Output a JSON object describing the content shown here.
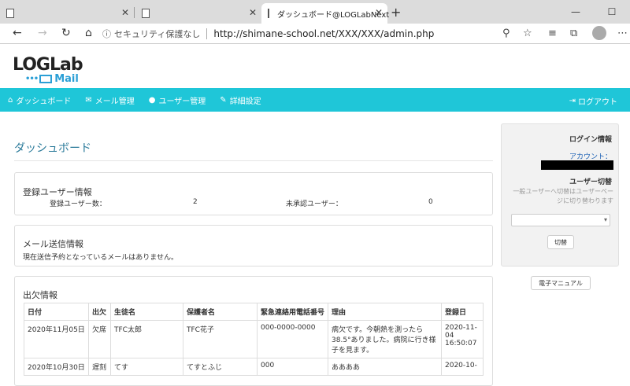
{
  "browser": {
    "tabs": [
      {
        "title": ""
      },
      {
        "title": ""
      },
      {
        "title": "ダッシュボード@LOGLabNext"
      }
    ],
    "insecure_label": "セキュリティ保護なし",
    "url": "http://shimane-school.net/XXX/XXX/admin.php"
  },
  "logo": {
    "main": "LOGLab",
    "sub": "Mail"
  },
  "nav": {
    "items": [
      {
        "label": "ダッシュボード",
        "icon": "home-icon"
      },
      {
        "label": "メール管理",
        "icon": "mail-icon"
      },
      {
        "label": "ユーザー管理",
        "icon": "user-icon"
      },
      {
        "label": "詳細設定",
        "icon": "wrench-icon"
      }
    ],
    "logout": "ログアウト"
  },
  "main": {
    "title": "ダッシュボード",
    "users_panel": {
      "title": "登録ユーザー情報",
      "registered_label": "登録ユーザー数：",
      "registered_value": "2",
      "pending_label": "未承認ユーザー：",
      "pending_value": "0"
    },
    "mail_panel": {
      "title": "メール送信情報",
      "message": "現在送信予約となっているメールはありません。"
    },
    "attendance_panel": {
      "title": "出欠情報",
      "columns": [
        "日付",
        "出欠",
        "生徒名",
        "保護者名",
        "緊急連絡用電話番号",
        "理由",
        "登録日"
      ],
      "rows": [
        [
          "2020年11月05日",
          "欠席",
          "TFC太郎",
          "TFC花子",
          "000-0000-0000",
          "病欠です。今朝熱を測ったら38.5°ありました。病院に行き様子を見ます。",
          "2020-11-04 16:50:07"
        ],
        [
          "2020年10月30日",
          "遅刻",
          "てす",
          "てすとふじ",
          "000",
          "ああああ",
          "2020-10-"
        ]
      ]
    }
  },
  "sidebar": {
    "title": "ログイン情報",
    "account_label": "アカウント：",
    "switch_title": "ユーザー切替",
    "switch_desc": "一般ユーザーへ切替はユーザーページに切り替わります",
    "switch_button": "切替",
    "manual_button": "電子マニュアル"
  }
}
